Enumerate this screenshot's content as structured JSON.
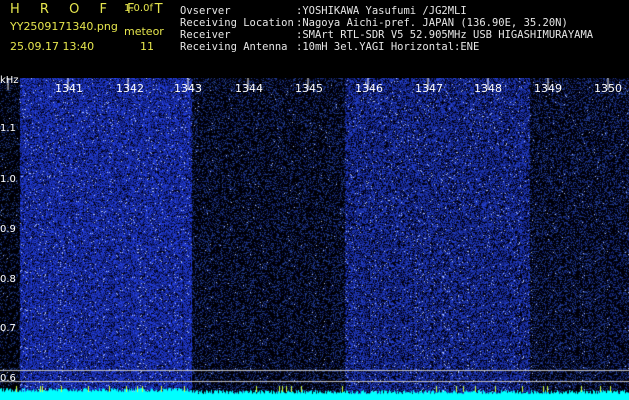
{
  "header": {
    "title": "H R O F F T",
    "version": "1.0.0f",
    "filename": "YY2509171340.png",
    "timestamp": "25.09.17 13:40",
    "meteor_label": "meteor",
    "meteor_count": "11"
  },
  "meta": [
    {
      "key": "Ovserver",
      "value": ":YOSHIKAWA Yasufumi /JG2MLI"
    },
    {
      "key": "Receiving Location",
      "value": ":Nagoya Aichi-pref. JAPAN (136.90E, 35.20N)"
    },
    {
      "key": "Receiver",
      "value": ":SMArt RTL-SDR V5 52.905MHz USB HIGASHIMURAYAMA"
    },
    {
      "key": "Receiving Antenna",
      "value": ":10mH 3el.YAGI Horizontal:ENE"
    }
  ],
  "axis": {
    "unit": "kHz",
    "time_ticks": [
      "1341",
      "1342",
      "1343",
      "1344",
      "1345",
      "1346",
      "1347",
      "1348",
      "1349",
      "1350"
    ],
    "freq_ticks": [
      "1.1",
      "1.0",
      "0.9",
      "0.8",
      "0.7",
      "0.6"
    ]
  },
  "colors": {
    "background": "#000000",
    "noise": "#1e30c8",
    "signal": "#00ffff",
    "header_yellow": "#e6e64d"
  }
}
